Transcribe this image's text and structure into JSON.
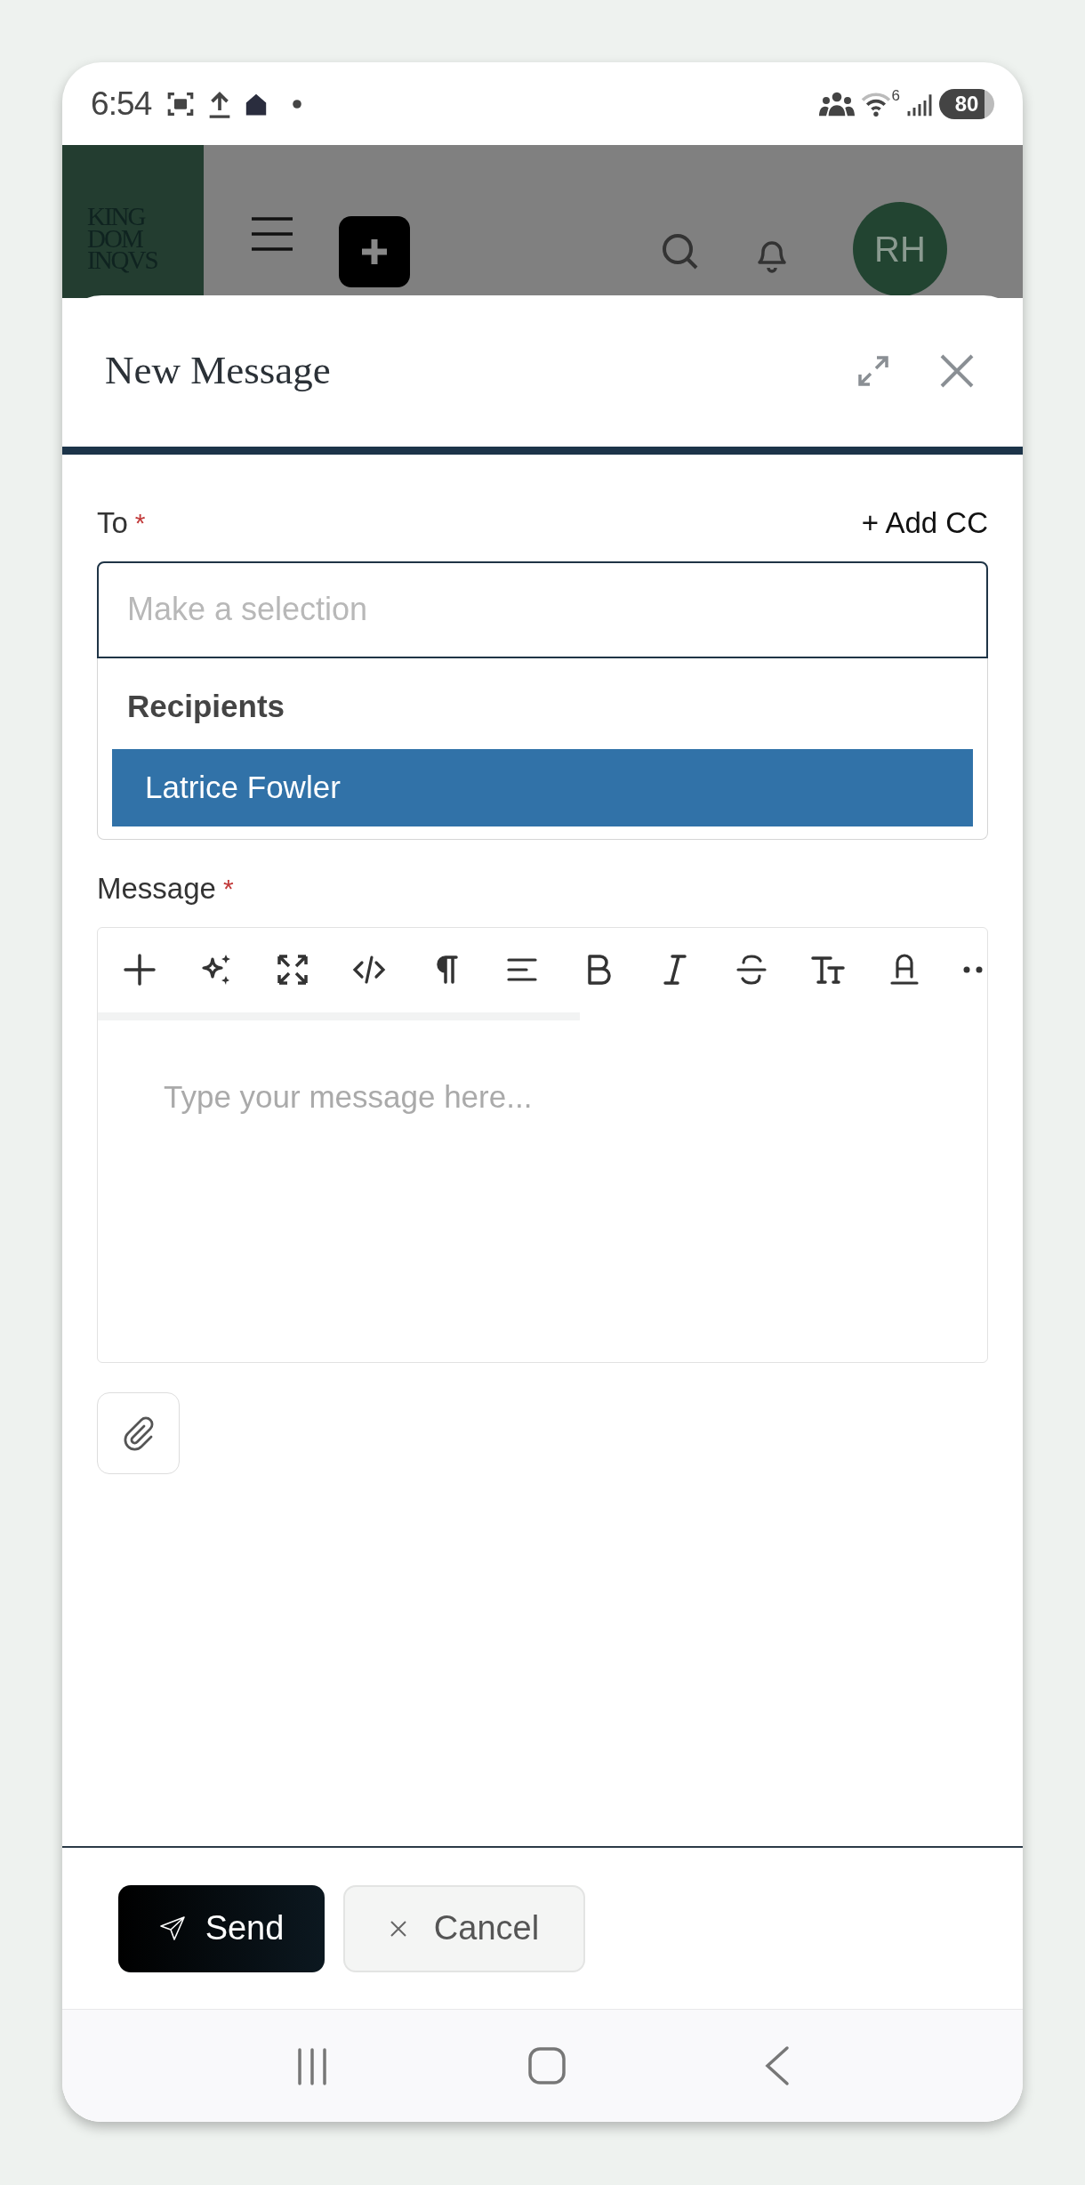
{
  "status_bar": {
    "time": "6:54",
    "wifi_band": "6",
    "battery": "80"
  },
  "header": {
    "logo_lines": [
      "KING",
      "DOM",
      "INQVS"
    ],
    "avatar": "RH"
  },
  "modal": {
    "title": "New Message",
    "to": {
      "label": "To",
      "required": "*",
      "add_cc": "+ Add CC",
      "placeholder": "Make a selection",
      "dropdown": {
        "group": "Recipients",
        "options": [
          {
            "label": "Latrice Fowler",
            "selected": true
          }
        ]
      }
    },
    "message": {
      "label": "Message",
      "required": "*",
      "placeholder": "Type your message here...",
      "toolbar": [
        {
          "kind": "plus"
        },
        {
          "kind": "sparkle"
        },
        {
          "kind": "fullscreen"
        },
        {
          "kind": "code"
        },
        {
          "kind": "paragraph"
        },
        {
          "kind": "align"
        },
        {
          "kind": "bold"
        },
        {
          "kind": "italic"
        },
        {
          "kind": "strike"
        },
        {
          "kind": "textsize"
        },
        {
          "kind": "textcolor"
        },
        {
          "kind": "more"
        }
      ]
    },
    "buttons": [
      {
        "kind": "send",
        "label": "Send"
      },
      {
        "kind": "cancel",
        "label": "Cancel"
      }
    ]
  }
}
